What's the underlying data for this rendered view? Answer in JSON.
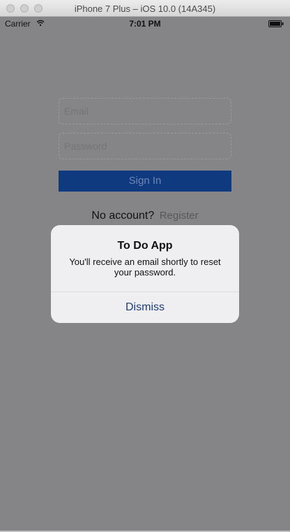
{
  "window": {
    "title": "iPhone 7 Plus – iOS 10.0 (14A345)"
  },
  "status_bar": {
    "carrier": "Carrier",
    "time": "7:01 PM",
    "icons": [
      "wifi-icon",
      "battery-icon"
    ]
  },
  "login": {
    "email_placeholder": "Email",
    "email_value": "",
    "password_placeholder": "Password",
    "password_value": "",
    "sign_in_label": "Sign In",
    "no_account_text": "No account?",
    "register_label": "Register"
  },
  "alert": {
    "title": "To Do App",
    "message": "You'll receive an email shortly to reset your password.",
    "action_label": "Dismiss"
  },
  "colors": {
    "dimmed_background": "#858587",
    "sign_in_button": "#0f3a7f",
    "alert_background": "#efeef1",
    "alert_action_text": "#1d3f77"
  }
}
